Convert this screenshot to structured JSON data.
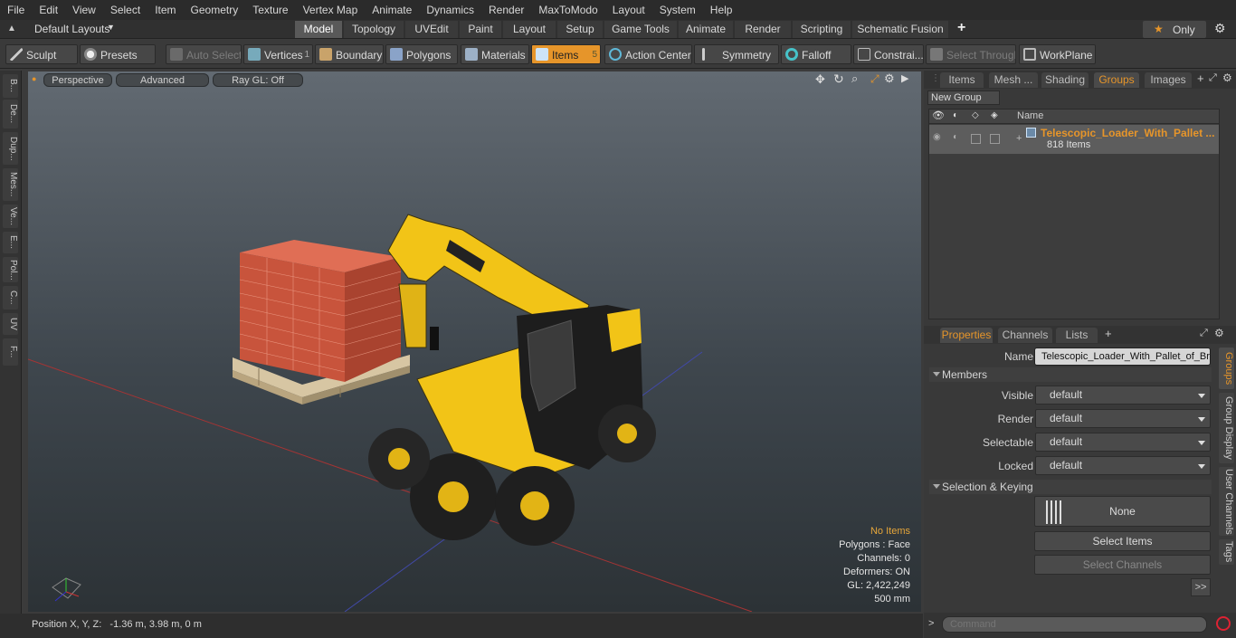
{
  "menu": [
    "File",
    "Edit",
    "View",
    "Select",
    "Item",
    "Geometry",
    "Texture",
    "Vertex Map",
    "Animate",
    "Dynamics",
    "Render",
    "MaxToModo",
    "Layout",
    "System",
    "Help"
  ],
  "layouts": {
    "label": "Default Layouts",
    "only_label": "Only",
    "tabs": [
      "Model",
      "Topology",
      "UVEdit",
      "Paint",
      "Layout",
      "Setup",
      "Game Tools",
      "Animate",
      "Render",
      "Scripting",
      "Schematic Fusion"
    ]
  },
  "toolbar": {
    "sculpt": "Sculpt",
    "presets": "Presets",
    "auto_select": "Auto Select",
    "vertices": "Vertices",
    "vertices_count": "1",
    "boundary": "Boundary",
    "polygons": "Polygons",
    "materials": "Materials",
    "items": "Items",
    "items_count": "5",
    "action_center": "Action Center",
    "symmetry": "Symmetry",
    "falloff": "Falloff",
    "constraints": "Constrai...",
    "select_through": "Select Through",
    "workplane": "WorkPlane"
  },
  "left_tabs": [
    "B...",
    "De...",
    "Dup...",
    "Mes...",
    "Ve...",
    "E...",
    "Pol...",
    "C...",
    "UV",
    "F..."
  ],
  "viewport": {
    "perspective": "Perspective",
    "advanced": "Advanced",
    "raygl": "Ray GL: Off",
    "stats": {
      "items": "No Items",
      "polygons": "Polygons : Face",
      "channels": "Channels: 0",
      "deformers": "Deformers: ON",
      "gl": "GL: 2,422,249",
      "scale": "500 mm"
    }
  },
  "status": {
    "position": "Position X, Y, Z:   -1.36 m, 3.98 m, 0 m"
  },
  "groups_panel": {
    "tabs": [
      "Items",
      "Mesh ...",
      "Shading",
      "Groups",
      "Images"
    ],
    "new_group": "New Group",
    "name_col": "Name",
    "group_name": "Telescopic_Loader_With_Pallet ...",
    "group_count": "818 Items"
  },
  "properties": {
    "tabs": [
      "Properties",
      "Channels",
      "Lists"
    ],
    "name_label": "Name",
    "name_value": "Telescopic_Loader_With_Pallet_of_Bri",
    "members_label": "Members",
    "visible_label": "Visible",
    "render_label": "Render",
    "selectable_label": "Selectable",
    "locked_label": "Locked",
    "default_value": "default",
    "sel_keying_label": "Selection & Keying",
    "none_label": "None",
    "select_items": "Select Items",
    "select_channels": "Select Channels",
    "more": ">>",
    "side_tabs": [
      "Groups",
      "Group Display",
      "User Channels",
      "Tags"
    ]
  },
  "command": {
    "placeholder": "Command"
  },
  "colors": {
    "accent": "#e6952a",
    "machine": "#f2c417"
  }
}
